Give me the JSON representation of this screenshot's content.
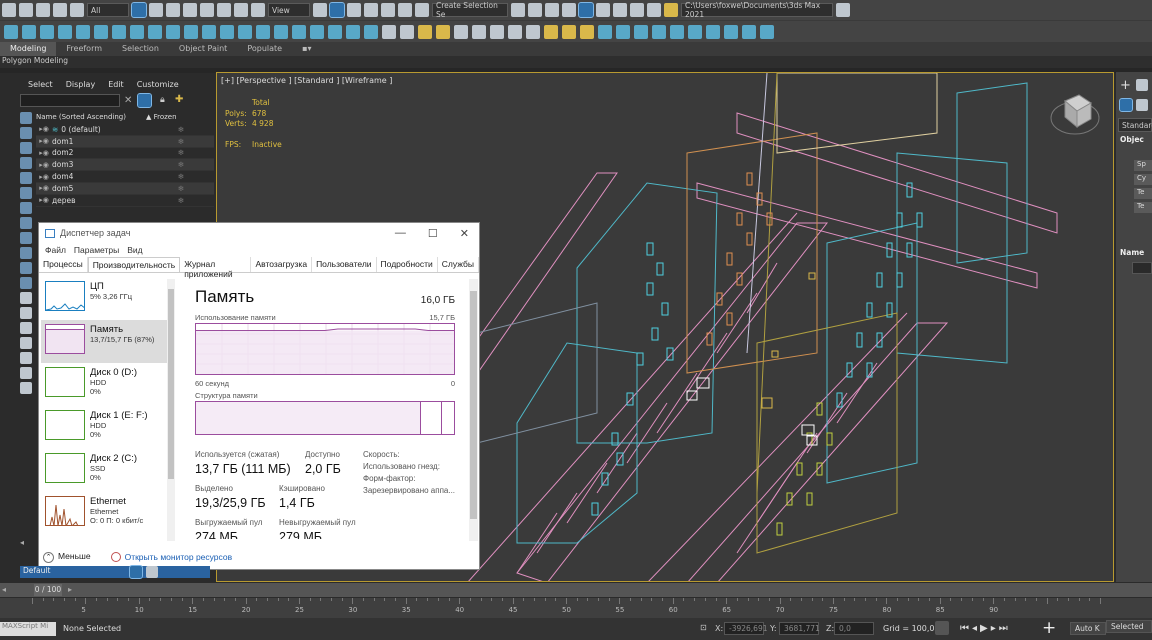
{
  "toolbar": {
    "filter_dropdown": "All",
    "view_dropdown": "View",
    "selection_set": "Create Selection Se",
    "path": "C:\\Users\\foxwe\\Documents\\3ds Max 2021"
  },
  "ribbon": {
    "tabs": [
      "Modeling",
      "Freeform",
      "Selection",
      "Object Paint",
      "Populate"
    ],
    "active": "Modeling"
  },
  "polygon_bar": "Polygon Modeling",
  "scene_explorer": {
    "menu": [
      "Select",
      "Display",
      "Edit",
      "Customize"
    ],
    "col_name": "Name (Sorted Ascending)",
    "col_frozen": "▲ Frozen",
    "rows": [
      "0 (default)",
      "dom1",
      "dom2",
      "dom3",
      "dom4",
      "dom5",
      "дерев"
    ]
  },
  "viewport": {
    "label": "[+] [Perspective ] [Standard ] [Wireframe ]",
    "stats_header": "Total",
    "polys_label": "Polys:",
    "polys_value": "678",
    "verts_label": "Verts:",
    "verts_value": "4 928",
    "fps_label": "FPS:",
    "fps_value": "Inactive"
  },
  "command_panel": {
    "dropdown": "Standard",
    "object_type": "Objec",
    "name_section": "Name",
    "buttons": [
      "Sp",
      "Cy",
      "Te",
      "Te"
    ]
  },
  "task_manager": {
    "title": "Диспетчер задач",
    "menu": [
      "Файл",
      "Параметры",
      "Вид"
    ],
    "tabs": [
      "Процессы",
      "Производительность",
      "Журнал приложений",
      "Автозагрузка",
      "Пользователи",
      "Подробности",
      "Службы"
    ],
    "active_tab": "Производительность",
    "resources": [
      {
        "name": "ЦП",
        "sub1": "5%  3,26 ГГц",
        "sub2": "",
        "color": "#1a7fc0"
      },
      {
        "name": "Память",
        "sub1": "13,7/15,7 ГБ (87%)",
        "sub2": "",
        "color": "#9b4d9e"
      },
      {
        "name": "Диск 0 (D:)",
        "sub1": "HDD",
        "sub2": "0%",
        "color": "#4a9a2a"
      },
      {
        "name": "Диск 1 (E: F:)",
        "sub1": "HDD",
        "sub2": "0%",
        "color": "#4a9a2a"
      },
      {
        "name": "Диск 2 (C:)",
        "sub1": "SSD",
        "sub2": "0%",
        "color": "#4a9a2a"
      },
      {
        "name": "Ethernet",
        "sub1": "Ethernet",
        "sub2": "О: 0 П: 0 кбит/с",
        "color": "#a0522d"
      }
    ],
    "memory": {
      "title": "Память",
      "total": "16,0 ГБ",
      "usage_label": "Использование памяти",
      "usage_max": "15,7 ГБ",
      "usage_fraction": 0.87,
      "axis_left": "60 секунд",
      "axis_right": "0",
      "structure_label": "Структура памяти",
      "in_use_label": "Используется (сжатая)",
      "in_use_value": "13,7 ГБ (111 МБ)",
      "available_label": "Доступно",
      "available_value": "2,0 ГБ",
      "committed_label": "Выделено",
      "committed_value": "19,3/25,9 ГБ",
      "cached_label": "Кэшировано",
      "cached_value": "1,4 ГБ",
      "paged_label": "Выгружаемый пул",
      "paged_value": "274 МБ",
      "nonpaged_label": "Невыгружаемый пул",
      "nonpaged_value": "279 МБ",
      "speed_label": "Скорость:",
      "slots_label": "Использовано гнезд:",
      "form_label": "Форм-фактор:",
      "reserved_label": "Зарезервировано аппа..."
    },
    "footer_less": "Меньше",
    "footer_link": "Открыть монитор ресурсов"
  },
  "layer_dropdown": "Default",
  "timeline": {
    "frame_box": "0 / 100",
    "ticks": [
      "5",
      "10",
      "15",
      "20",
      "25",
      "30",
      "35",
      "40",
      "45",
      "50",
      "55",
      "60",
      "65",
      "70",
      "75",
      "80",
      "85",
      "90"
    ]
  },
  "status": {
    "selection": "None Selected",
    "x_label": "X:",
    "x_value": "-3926,691",
    "y_label": "Y:",
    "y_value": "3681,771",
    "z_label": "Z:",
    "z_value": "0,0",
    "grid": "Grid = 100,0",
    "autokey": "Auto K",
    "selected": "Selected"
  }
}
